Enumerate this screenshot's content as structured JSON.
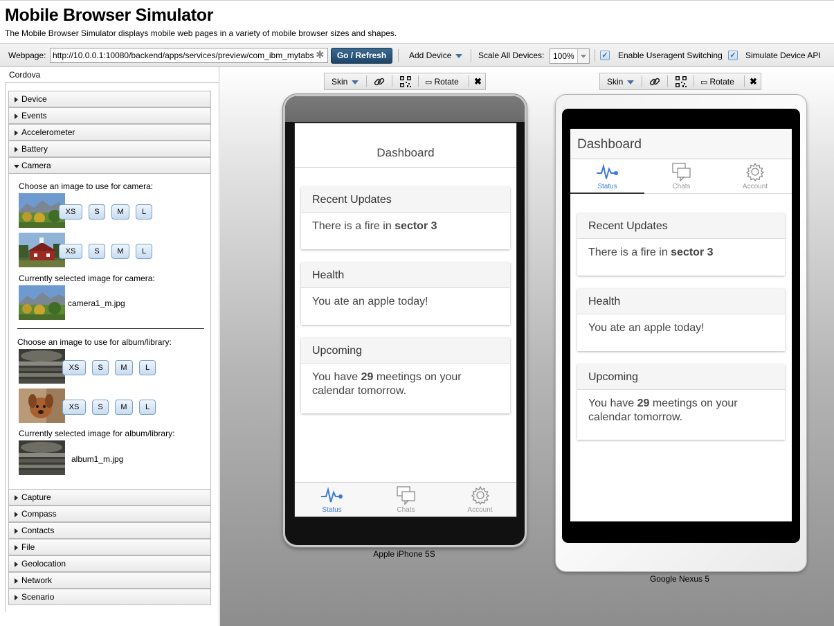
{
  "header": {
    "title": "Mobile Browser Simulator",
    "subtitle": "The Mobile Browser Simulator displays mobile web pages in a variety of mobile browser sizes and shapes."
  },
  "toolbar": {
    "webpage_label": "Webpage:",
    "url_value": "http://10.0.0.1:10080/backend/apps/services/preview/com_ibm_mytabs",
    "go_label": "Go / Refresh",
    "add_device_label": "Add Device",
    "scale_label": "Scale All Devices:",
    "scale_value": "100%",
    "useragent_label": "Enable Useragent Switching",
    "useragent_checked": true,
    "simulate_api_label": "Simulate Device API",
    "simulate_api_checked": true
  },
  "sidebar": {
    "title": "Cordova",
    "items": [
      {
        "label": "Device",
        "open": false
      },
      {
        "label": "Events",
        "open": false
      },
      {
        "label": "Accelerometer",
        "open": false
      },
      {
        "label": "Battery",
        "open": false
      },
      {
        "label": "Camera",
        "open": true
      },
      {
        "label": "Capture",
        "open": false
      },
      {
        "label": "Compass",
        "open": false
      },
      {
        "label": "Contacts",
        "open": false
      },
      {
        "label": "File",
        "open": false
      },
      {
        "label": "Geolocation",
        "open": false
      },
      {
        "label": "Network",
        "open": false
      },
      {
        "label": "Scenario",
        "open": false
      }
    ],
    "camera": {
      "choose_camera": "Choose an image to use for camera:",
      "selected_camera": "Currently selected image for camera:",
      "selected_camera_file": "camera1_m.jpg",
      "choose_album": "Choose an image to use for album/library:",
      "selected_album": "Currently selected image for album/library:",
      "selected_album_file": "album1_m.jpg",
      "sizes": [
        "XS",
        "S",
        "M",
        "L"
      ]
    }
  },
  "device_toolbar": {
    "skin_label": "Skin",
    "rotate_label": "Rotate"
  },
  "devices": [
    {
      "name": "Apple iPhone 5S"
    },
    {
      "name": "Google Nexus 5"
    }
  ],
  "app": {
    "page_title": "Dashboard",
    "tabs": [
      {
        "label": "Status",
        "icon": "pulse-icon",
        "active": true
      },
      {
        "label": "Chats",
        "icon": "chat-bubbles-icon",
        "active": false
      },
      {
        "label": "Account",
        "icon": "gear-icon",
        "active": false
      }
    ],
    "cards": [
      {
        "title": "Recent Updates",
        "body_pre": "There is a fire in ",
        "body_bold": "sector 3",
        "body_post": ""
      },
      {
        "title": "Health",
        "body_pre": "You ate an apple today!",
        "body_bold": "",
        "body_post": ""
      },
      {
        "title": "Upcoming",
        "body_pre": "You have ",
        "body_bold": "29",
        "body_post": " meetings on your calendar tomorrow."
      }
    ],
    "accent_color": "#3a7ad8"
  }
}
